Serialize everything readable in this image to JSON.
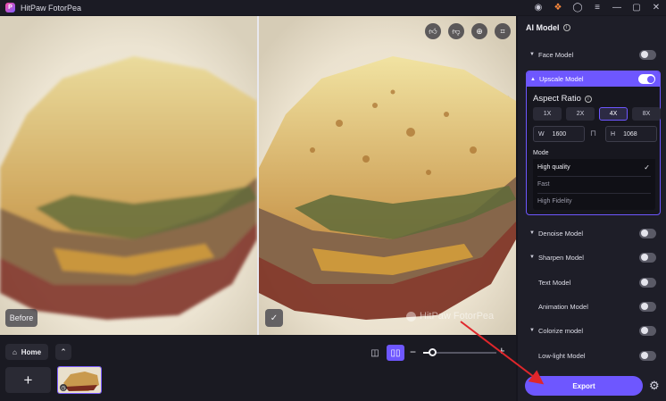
{
  "titlebar": {
    "app_title": "HitPaw FotorPea",
    "logo_letter": "P",
    "icons": [
      "discord-icon",
      "gift-icon",
      "account-icon",
      "menu-icon",
      "minimize-icon",
      "maximize-icon",
      "close-icon"
    ]
  },
  "viewer": {
    "before_label": "Before",
    "check_glyph": "✓",
    "watermark_text": "HitPaw FotorPea",
    "tools": [
      "thumbs-up-icon",
      "thumbs-down-icon",
      "zoom-icon",
      "crop-icon"
    ]
  },
  "bottom": {
    "home_label": "Home",
    "add_glyph": "+",
    "zoom_minus": "−",
    "zoom_plus": "+",
    "zoom_level": 0.12
  },
  "panel": {
    "title": "AI Model",
    "face_model": "Face Model",
    "upscale_model": "Upscale Model",
    "aspect_ratio_title": "Aspect Ratio",
    "scales": [
      "1X",
      "2X",
      "4X",
      "8X"
    ],
    "active_scale": "4X",
    "width_key": "W",
    "width_value": "1600",
    "height_key": "H",
    "height_value": "1068",
    "mode_label": "Mode",
    "modes": [
      "High quality",
      "Fast",
      "High Fidelity"
    ],
    "selected_mode": "High quality",
    "models": {
      "denoise": "Denoise Model",
      "sharpen": "Sharpen Model",
      "text": "Text Model",
      "animation": "Animation Model",
      "colorize": "Colorize model",
      "lowlight": "Low-light Model"
    },
    "export_label": "Export"
  },
  "colors": {
    "accent": "#6e57ff",
    "annotation_arrow": "#e0262b"
  }
}
